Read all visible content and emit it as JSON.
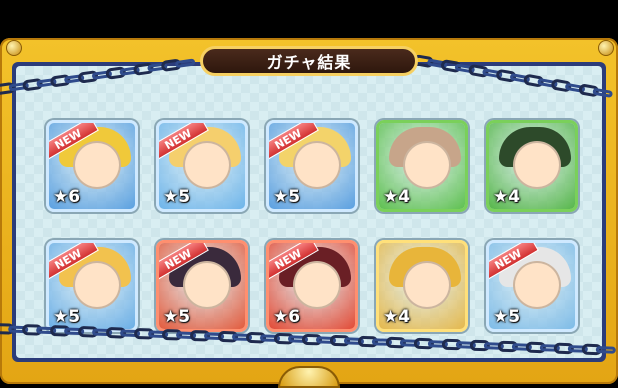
{
  "title": "ガチャ結果",
  "new_label": "NEW",
  "star_symbol": "★",
  "results": [
    {
      "rarity": "6",
      "is_new": true,
      "element": "water",
      "hair": "#f0c93a",
      "bg": "#5aa0e0"
    },
    {
      "rarity": "5",
      "is_new": true,
      "element": "water",
      "hair": "#f5cf6d",
      "bg": "#6db4ea"
    },
    {
      "rarity": "5",
      "is_new": true,
      "element": "water",
      "hair": "#f3d36a",
      "bg": "#5a9fe0"
    },
    {
      "rarity": "4",
      "is_new": false,
      "element": "wood",
      "hair": "#c7a58a",
      "bg": "#5ec050"
    },
    {
      "rarity": "4",
      "is_new": false,
      "element": "wood",
      "hair": "#2d4a2a",
      "bg": "#56b64a"
    },
    {
      "rarity": "5",
      "is_new": true,
      "element": "water",
      "hair": "#f2c24e",
      "bg": "#6aaee6"
    },
    {
      "rarity": "5",
      "is_new": true,
      "element": "fire",
      "hair": "#3a2a3c",
      "bg": "#e25a3c"
    },
    {
      "rarity": "6",
      "is_new": true,
      "element": "fire",
      "hair": "#6a1f25",
      "bg": "#e24a35"
    },
    {
      "rarity": "4",
      "is_new": false,
      "element": "light",
      "hair": "#e8b53a",
      "bg": "#e4b84c"
    },
    {
      "rarity": "5",
      "is_new": true,
      "element": "water",
      "hair": "#e6e6e6",
      "bg": "#7dbbe7"
    }
  ]
}
